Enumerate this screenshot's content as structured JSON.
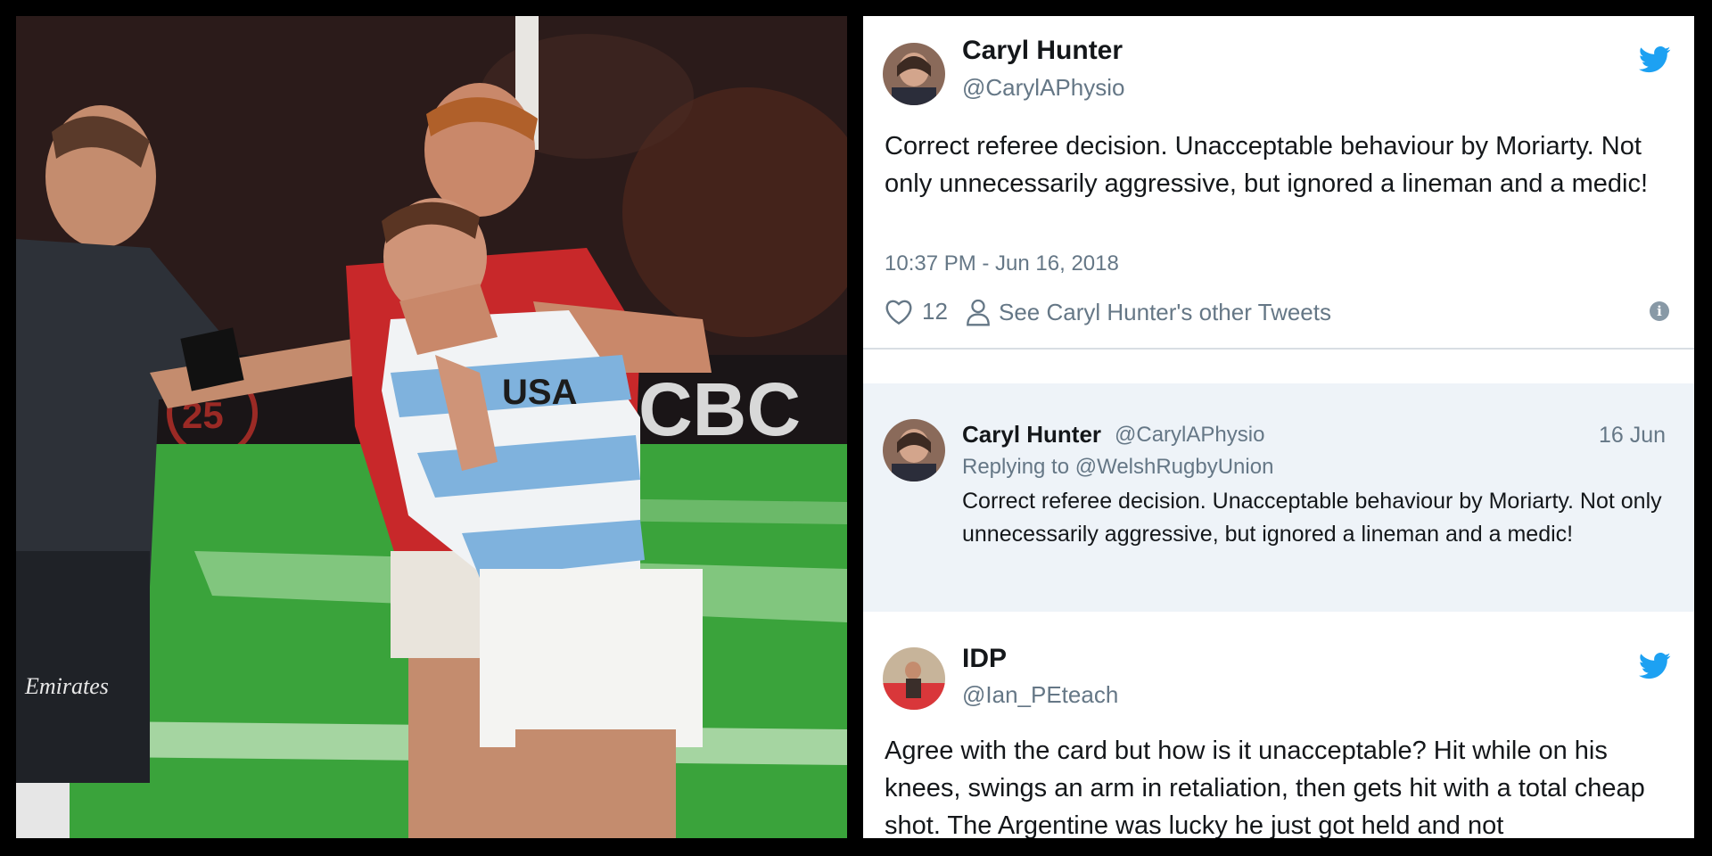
{
  "tweet_main": {
    "name": "Caryl Hunter",
    "handle": "@CarylAPhysio",
    "text": "Correct referee decision. Unacceptable behaviour by Moriarty. Not only unnecessarily aggressive, but ignored a lineman and a medic!",
    "timestamp": "10:37 PM - Jun 16, 2018",
    "likes": "12",
    "other_tweets_label": "See Caryl Hunter's other Tweets",
    "icons": [
      "twitter-bird-icon",
      "heart-icon",
      "person-icon",
      "info-icon"
    ]
  },
  "tweet_reply": {
    "name": "Caryl Hunter",
    "handle": "@CarylAPhysio",
    "date": "16 Jun",
    "replying_to": "Replying to @WelshRugbyUnion",
    "text": "Correct referee decision. Unacceptable behaviour by Moriarty. Not only unnecessarily aggressive, but ignored a lineman and a medic!"
  },
  "tweet_third": {
    "name": "IDP",
    "handle": "@Ian_PEteach",
    "text": "Agree with the card but how is it unacceptable? Hit while on his knees, swings an arm in retaliation, then gets hit with a total cheap shot. The Argentine was lucky he just got held and not"
  },
  "photo": {
    "board_text": "CBC",
    "shirt_text": "USA",
    "badge_text": "25",
    "sleeve_text": "Emirates"
  },
  "colors": {
    "twitter_blue": "#1da1f2",
    "secondary_text": "#657786",
    "reply_bg": "#eef3f8"
  }
}
